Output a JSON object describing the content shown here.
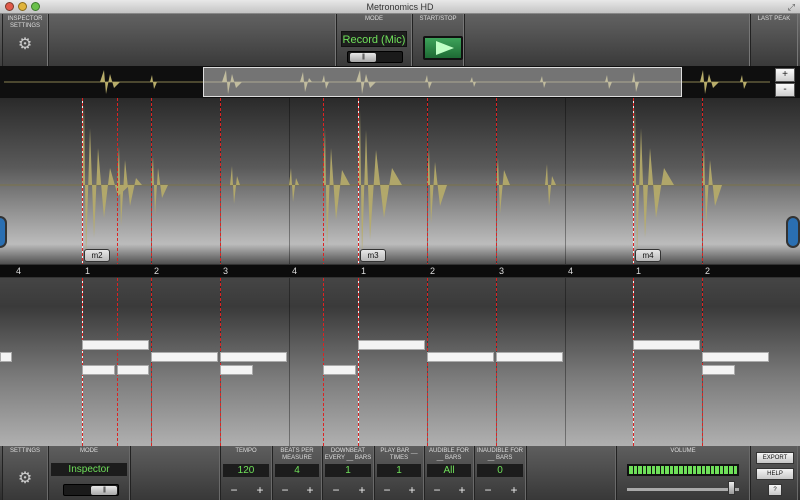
{
  "window": {
    "title": "Metronomics HD"
  },
  "top": {
    "inspector_settings_label": "INSPECTOR SETTINGS",
    "mode_label": "MODE",
    "mode_value": "Record (Mic)",
    "start_stop_label": "START/STOP",
    "last_peak_label": "LAST PEAK"
  },
  "overview": {
    "zoom_in": "+",
    "zoom_out": "-"
  },
  "ruler": {
    "numbers": [
      "4",
      "1",
      "2",
      "3",
      "4",
      "1",
      "2",
      "3",
      "4",
      "1",
      "2"
    ]
  },
  "markers": [
    "m2",
    "m3",
    "m4"
  ],
  "bottom": {
    "settings_label": "SETTINGS",
    "mode_label": "MODE",
    "mode_value": "Inspector",
    "tempo": {
      "label": "TEMPO",
      "value": "120"
    },
    "beats_per_measure": {
      "label": "BEATS PER MEASURE",
      "value": "4"
    },
    "downbeat": {
      "label": "DOWNBEAT EVERY __ BARS",
      "value": "1"
    },
    "play_bar": {
      "label": "PLAY BAR __ TIMES",
      "value": "1"
    },
    "audible": {
      "label": "AUDIBLE FOR __ BARS",
      "value": "All"
    },
    "inaudible": {
      "label": "INAUDIBLE FOR __ BARS",
      "value": "0"
    },
    "volume_label": "VOLUME",
    "volume_level": 0.95,
    "export_label": "EXPORT",
    "help_label": "HELP",
    "question_label": "?",
    "minus": "−",
    "plus": "+"
  },
  "colors": {
    "accent_green": "#6fe05a",
    "waveform": "#b8ad6a",
    "hit_line": "#dd2222"
  }
}
